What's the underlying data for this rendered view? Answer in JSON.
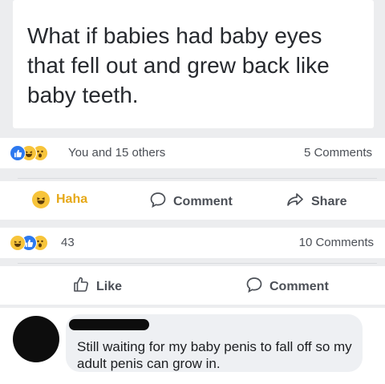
{
  "post": {
    "text": "What if babies had baby eyes that fell out and grew back like baby teeth."
  },
  "reactions_row_1": {
    "icons": [
      "like-icon",
      "haha-icon",
      "wow-icon"
    ],
    "summary": "You and 15 others",
    "comments": "5 Comments"
  },
  "actions_row_1": {
    "reaction_label": "Haha",
    "comment_label": "Comment",
    "share_label": "Share"
  },
  "reactions_row_2": {
    "icons": [
      "haha-icon",
      "like-icon",
      "wow-icon"
    ],
    "count": "43",
    "comments": "10 Comments"
  },
  "actions_row_2": {
    "like_label": "Like",
    "comment_label": "Comment"
  },
  "comment": {
    "text": "Still waiting for my baby penis to fall off so my adult penis can grow in."
  },
  "colors": {
    "like_blue": "#2d79ef",
    "haha_yellow": "#f7c43a",
    "text_gray": "#4b4f56"
  }
}
